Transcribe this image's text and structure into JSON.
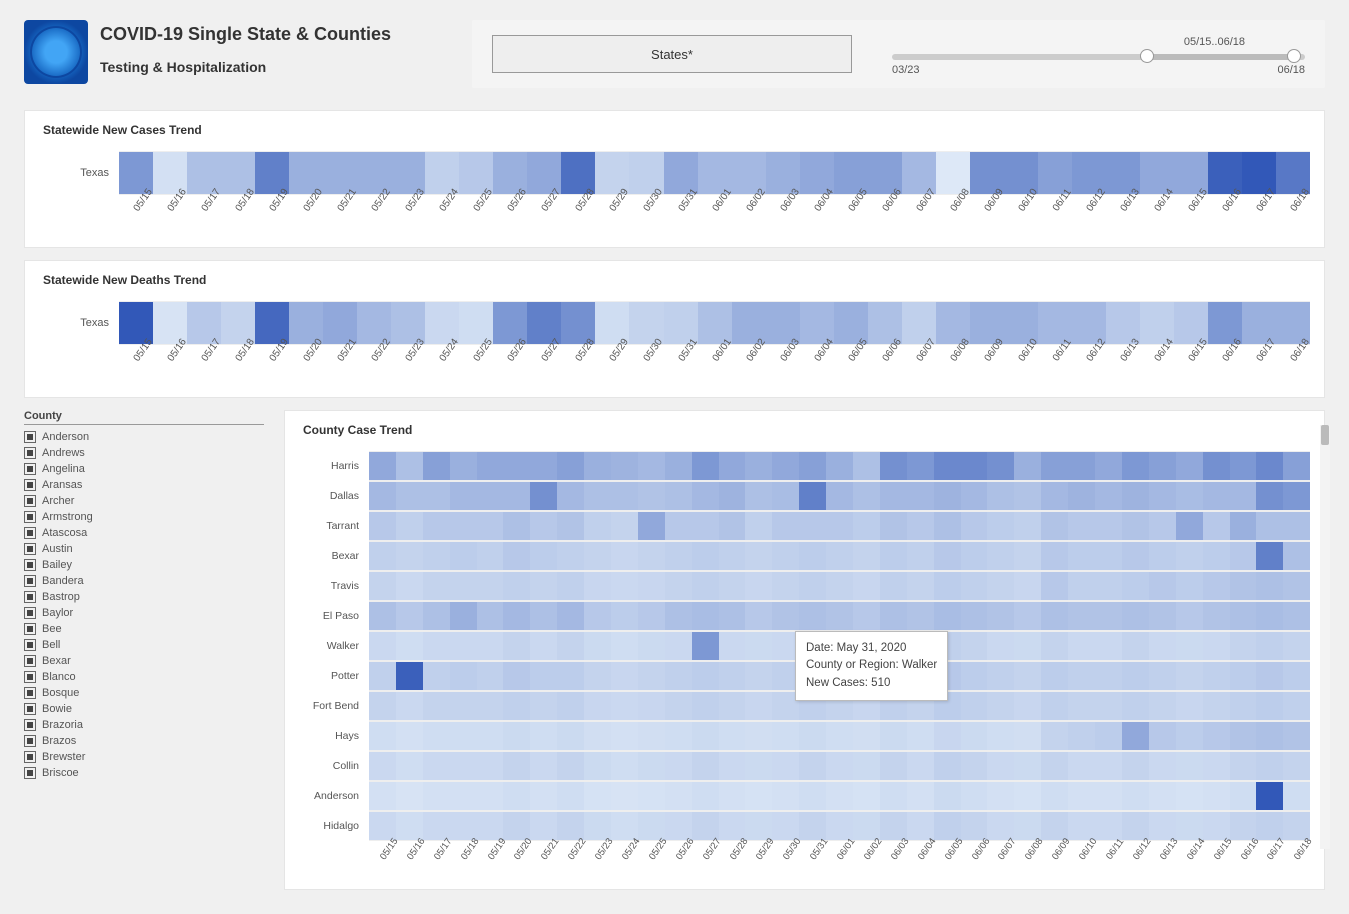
{
  "header": {
    "title": "COVID-19 Single State & Counties",
    "subtitle": "Testing & Hospitalization",
    "states_button": "States*",
    "slider": {
      "range_label": "05/15..06/18",
      "min_label": "03/23",
      "max_label": "06/18"
    }
  },
  "dates": [
    "05/15",
    "05/16",
    "05/17",
    "05/18",
    "05/19",
    "05/20",
    "05/21",
    "05/22",
    "05/23",
    "05/24",
    "05/25",
    "05/26",
    "05/27",
    "05/28",
    "05/29",
    "05/30",
    "05/31",
    "06/01",
    "06/02",
    "06/03",
    "06/04",
    "06/05",
    "06/06",
    "06/07",
    "06/08",
    "06/09",
    "06/10",
    "06/11",
    "06/12",
    "06/13",
    "06/14",
    "06/15",
    "06/16",
    "06/17",
    "06/18"
  ],
  "chart_data": [
    {
      "type": "heatmap",
      "title": "Statewide New Cases Trend",
      "ylabel": "",
      "xlabel": "",
      "categories": [
        "05/15",
        "05/16",
        "05/17",
        "05/18",
        "05/19",
        "05/20",
        "05/21",
        "05/22",
        "05/23",
        "05/24",
        "05/25",
        "05/26",
        "05/27",
        "05/28",
        "05/29",
        "05/30",
        "05/31",
        "06/01",
        "06/02",
        "06/03",
        "06/04",
        "06/05",
        "06/06",
        "06/07",
        "06/08",
        "06/09",
        "06/10",
        "06/11",
        "06/12",
        "06/13",
        "06/14",
        "06/15",
        "06/16",
        "06/17",
        "06/18"
      ],
      "series": [
        {
          "name": "Texas",
          "values": [
            55,
            10,
            30,
            30,
            70,
            40,
            40,
            40,
            40,
            20,
            25,
            40,
            45,
            80,
            18,
            20,
            45,
            35,
            35,
            40,
            45,
            50,
            50,
            35,
            5,
            60,
            60,
            50,
            55,
            55,
            45,
            45,
            90,
            95,
            75
          ]
        }
      ],
      "value_scale": "0-100 relative intensity"
    },
    {
      "type": "heatmap",
      "title": "Statewide New Deaths Trend",
      "ylabel": "",
      "xlabel": "",
      "categories": [
        "05/15",
        "05/16",
        "05/17",
        "05/18",
        "05/19",
        "05/20",
        "05/21",
        "05/22",
        "05/23",
        "05/24",
        "05/25",
        "05/26",
        "05/27",
        "05/28",
        "05/29",
        "05/30",
        "05/31",
        "06/01",
        "06/02",
        "06/03",
        "06/04",
        "06/05",
        "06/06",
        "06/07",
        "06/08",
        "06/09",
        "06/10",
        "06/11",
        "06/12",
        "06/13",
        "06/14",
        "06/15",
        "06/16",
        "06/17",
        "06/18"
      ],
      "series": [
        {
          "name": "Texas",
          "values": [
            95,
            8,
            25,
            18,
            85,
            40,
            45,
            35,
            30,
            15,
            12,
            55,
            70,
            60,
            12,
            18,
            20,
            30,
            40,
            40,
            35,
            40,
            30,
            20,
            35,
            40,
            40,
            35,
            35,
            25,
            20,
            25,
            55,
            40,
            40
          ]
        }
      ],
      "value_scale": "0-100 relative intensity"
    },
    {
      "type": "heatmap",
      "title": "County Case Trend",
      "ylabel": "",
      "xlabel": "",
      "categories": [
        "05/15",
        "05/16",
        "05/17",
        "05/18",
        "05/19",
        "05/20",
        "05/21",
        "05/22",
        "05/23",
        "05/24",
        "05/25",
        "05/26",
        "05/27",
        "05/28",
        "05/29",
        "05/30",
        "05/31",
        "06/01",
        "06/02",
        "06/03",
        "06/04",
        "06/05",
        "06/06",
        "06/07",
        "06/08",
        "06/09",
        "06/10",
        "06/11",
        "06/12",
        "06/13",
        "06/14",
        "06/15",
        "06/16",
        "06/17",
        "06/18"
      ],
      "series": [
        {
          "name": "Harris",
          "values": [
            45,
            30,
            50,
            40,
            45,
            45,
            45,
            50,
            40,
            38,
            35,
            40,
            55,
            45,
            40,
            45,
            50,
            40,
            30,
            60,
            55,
            65,
            65,
            60,
            40,
            50,
            50,
            45,
            55,
            50,
            45,
            60,
            55,
            65,
            50
          ]
        },
        {
          "name": "Dallas",
          "values": [
            35,
            30,
            30,
            35,
            35,
            35,
            60,
            35,
            30,
            30,
            28,
            30,
            35,
            38,
            30,
            32,
            70,
            35,
            30,
            35,
            35,
            38,
            35,
            30,
            28,
            35,
            38,
            35,
            38,
            35,
            32,
            35,
            35,
            60,
            55
          ]
        },
        {
          "name": "Tarrant",
          "values": [
            25,
            20,
            25,
            25,
            25,
            30,
            25,
            28,
            20,
            18,
            45,
            25,
            25,
            28,
            20,
            25,
            25,
            25,
            22,
            28,
            25,
            30,
            25,
            22,
            20,
            28,
            25,
            25,
            28,
            25,
            45,
            25,
            40,
            30,
            30
          ]
        },
        {
          "name": "Bexar",
          "values": [
            20,
            18,
            20,
            22,
            20,
            25,
            22,
            20,
            18,
            16,
            18,
            20,
            22,
            20,
            18,
            20,
            22,
            20,
            18,
            22,
            20,
            25,
            22,
            20,
            18,
            25,
            22,
            22,
            25,
            22,
            20,
            22,
            25,
            70,
            30
          ]
        },
        {
          "name": "Travis",
          "values": [
            18,
            15,
            18,
            18,
            18,
            20,
            18,
            20,
            16,
            15,
            16,
            18,
            20,
            18,
            16,
            18,
            20,
            18,
            16,
            20,
            18,
            22,
            20,
            18,
            16,
            25,
            20,
            20,
            22,
            25,
            22,
            25,
            28,
            30,
            28
          ]
        },
        {
          "name": "El Paso",
          "values": [
            30,
            25,
            30,
            40,
            30,
            35,
            30,
            35,
            25,
            22,
            25,
            30,
            32,
            30,
            25,
            28,
            30,
            28,
            25,
            30,
            28,
            32,
            30,
            28,
            25,
            30,
            28,
            28,
            30,
            28,
            25,
            28,
            30,
            32,
            30
          ]
        },
        {
          "name": "Walker",
          "values": [
            15,
            12,
            15,
            15,
            15,
            18,
            15,
            18,
            14,
            12,
            14,
            15,
            55,
            15,
            14,
            15,
            18,
            60,
            14,
            18,
            15,
            20,
            18,
            15,
            14,
            18,
            15,
            15,
            18,
            15,
            14,
            15,
            18,
            20,
            18
          ]
        },
        {
          "name": "Potter",
          "values": [
            20,
            90,
            20,
            22,
            20,
            25,
            22,
            22,
            18,
            16,
            18,
            20,
            22,
            20,
            18,
            20,
            22,
            20,
            18,
            22,
            20,
            25,
            22,
            20,
            18,
            22,
            20,
            20,
            22,
            20,
            18,
            20,
            22,
            25,
            22
          ]
        },
        {
          "name": "Fort Bend",
          "values": [
            18,
            15,
            18,
            18,
            18,
            20,
            18,
            20,
            16,
            15,
            16,
            18,
            20,
            18,
            16,
            18,
            20,
            18,
            16,
            20,
            18,
            22,
            20,
            18,
            16,
            20,
            18,
            18,
            20,
            18,
            16,
            18,
            20,
            22,
            20
          ]
        },
        {
          "name": "Hays",
          "values": [
            12,
            10,
            12,
            12,
            12,
            14,
            12,
            14,
            11,
            10,
            11,
            12,
            14,
            12,
            11,
            12,
            14,
            12,
            11,
            14,
            12,
            16,
            14,
            12,
            11,
            18,
            20,
            22,
            45,
            25,
            22,
            25,
            28,
            30,
            28
          ]
        },
        {
          "name": "Collin",
          "values": [
            15,
            12,
            15,
            15,
            15,
            18,
            15,
            18,
            14,
            12,
            14,
            15,
            18,
            15,
            14,
            15,
            18,
            15,
            14,
            18,
            15,
            20,
            18,
            15,
            14,
            18,
            15,
            15,
            18,
            15,
            14,
            15,
            18,
            20,
            18
          ]
        },
        {
          "name": "Anderson",
          "values": [
            10,
            8,
            10,
            10,
            10,
            12,
            10,
            12,
            9,
            8,
            9,
            10,
            12,
            10,
            9,
            10,
            12,
            10,
            9,
            12,
            10,
            14,
            12,
            10,
            9,
            12,
            10,
            10,
            12,
            10,
            9,
            10,
            12,
            95,
            12
          ]
        },
        {
          "name": "Hidalgo",
          "values": [
            15,
            12,
            15,
            15,
            15,
            18,
            15,
            18,
            14,
            12,
            14,
            15,
            18,
            15,
            14,
            15,
            18,
            15,
            14,
            18,
            15,
            20,
            18,
            15,
            14,
            18,
            15,
            15,
            18,
            15,
            14,
            15,
            18,
            20,
            18
          ]
        }
      ],
      "value_scale": "0-100 relative intensity"
    }
  ],
  "county_filter": {
    "title": "County",
    "items": [
      "Anderson",
      "Andrews",
      "Angelina",
      "Aransas",
      "Archer",
      "Armstrong",
      "Atascosa",
      "Austin",
      "Bailey",
      "Bandera",
      "Bastrop",
      "Baylor",
      "Bee",
      "Bell",
      "Bexar",
      "Blanco",
      "Bosque",
      "Bowie",
      "Brazoria",
      "Brazos",
      "Brewster",
      "Briscoe"
    ]
  },
  "tooltip": {
    "line1": "Date: May 31, 2020",
    "line2": "County or Region: Walker",
    "line3": "New Cases:  510"
  }
}
